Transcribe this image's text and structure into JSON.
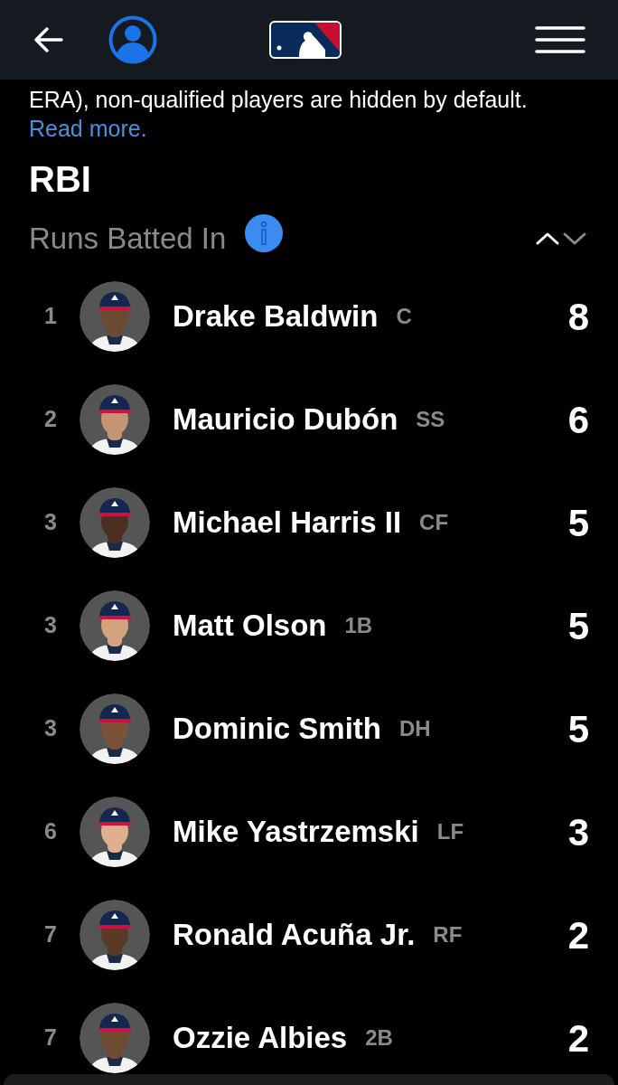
{
  "intro": {
    "text": "ERA), non-qualified players are hidden by default.",
    "link": "Read more."
  },
  "stat": {
    "title": "RBI",
    "subtitle": "Runs Batted In"
  },
  "sort": [
    {
      "kind": "up",
      "selected": true
    },
    {
      "kind": "down",
      "selected": false
    }
  ],
  "players": [
    {
      "rank": "1",
      "name": "Drake Baldwin",
      "position": "C",
      "value": "8"
    },
    {
      "rank": "2",
      "name": "Mauricio Dubón",
      "position": "SS",
      "value": "6"
    },
    {
      "rank": "3",
      "name": "Michael Harris II",
      "position": "CF",
      "value": "5"
    },
    {
      "rank": "3",
      "name": "Matt Olson",
      "position": "1B",
      "value": "5"
    },
    {
      "rank": "3",
      "name": "Dominic Smith",
      "position": "DH",
      "value": "5"
    },
    {
      "rank": "6",
      "name": "Mike Yastrzemski",
      "position": "LF",
      "value": "3"
    },
    {
      "rank": "7",
      "name": "Ronald Acuña Jr.",
      "position": "RF",
      "value": "2"
    },
    {
      "rank": "7",
      "name": "Ozzie Albies",
      "position": "2B",
      "value": "2"
    }
  ]
}
